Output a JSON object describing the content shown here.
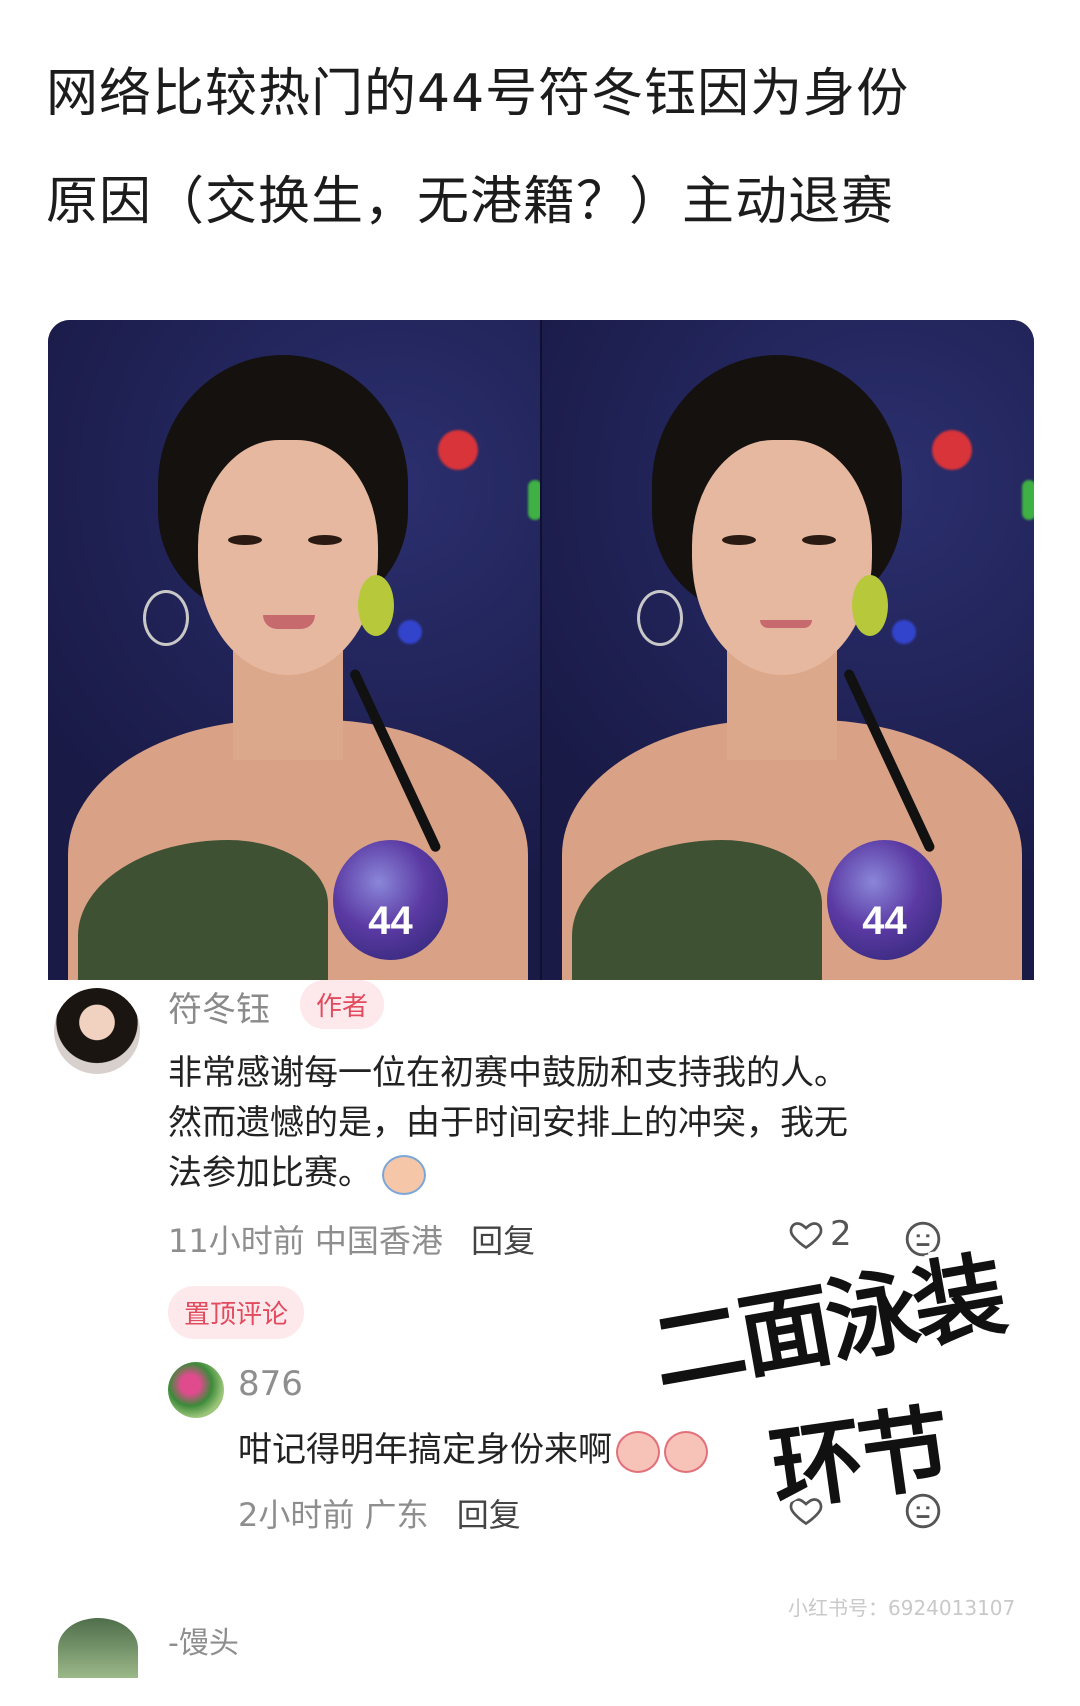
{
  "headline": {
    "line1": "网络比较热门的44号符冬钰因为身份",
    "line2": "原因（交换生，无港籍？）主动退赛"
  },
  "photo": {
    "badge_number": "44"
  },
  "author_comment": {
    "name": "符冬钰",
    "tag": "作者",
    "text_line1": "非常感谢每一位在初赛中鼓励和支持我的人。",
    "text_line2": "然而遗憾的是，由于时间安排上的冲突，我无",
    "text_line3": "法参加比赛。",
    "time": "11小时前",
    "location": "中国香港",
    "reply_label": "回复",
    "like_count": "2",
    "pinned_label": "置顶评论"
  },
  "reply_comment": {
    "name": "876",
    "text": "咁记得明年搞定身份来啊",
    "time": "2小时前",
    "location": "广东",
    "reply_label": "回复"
  },
  "overlay": {
    "line1": "二面泳装",
    "line2": "环节"
  },
  "watermark": "小红书号：6924013107",
  "next_comment": {
    "name": "-馒头"
  }
}
